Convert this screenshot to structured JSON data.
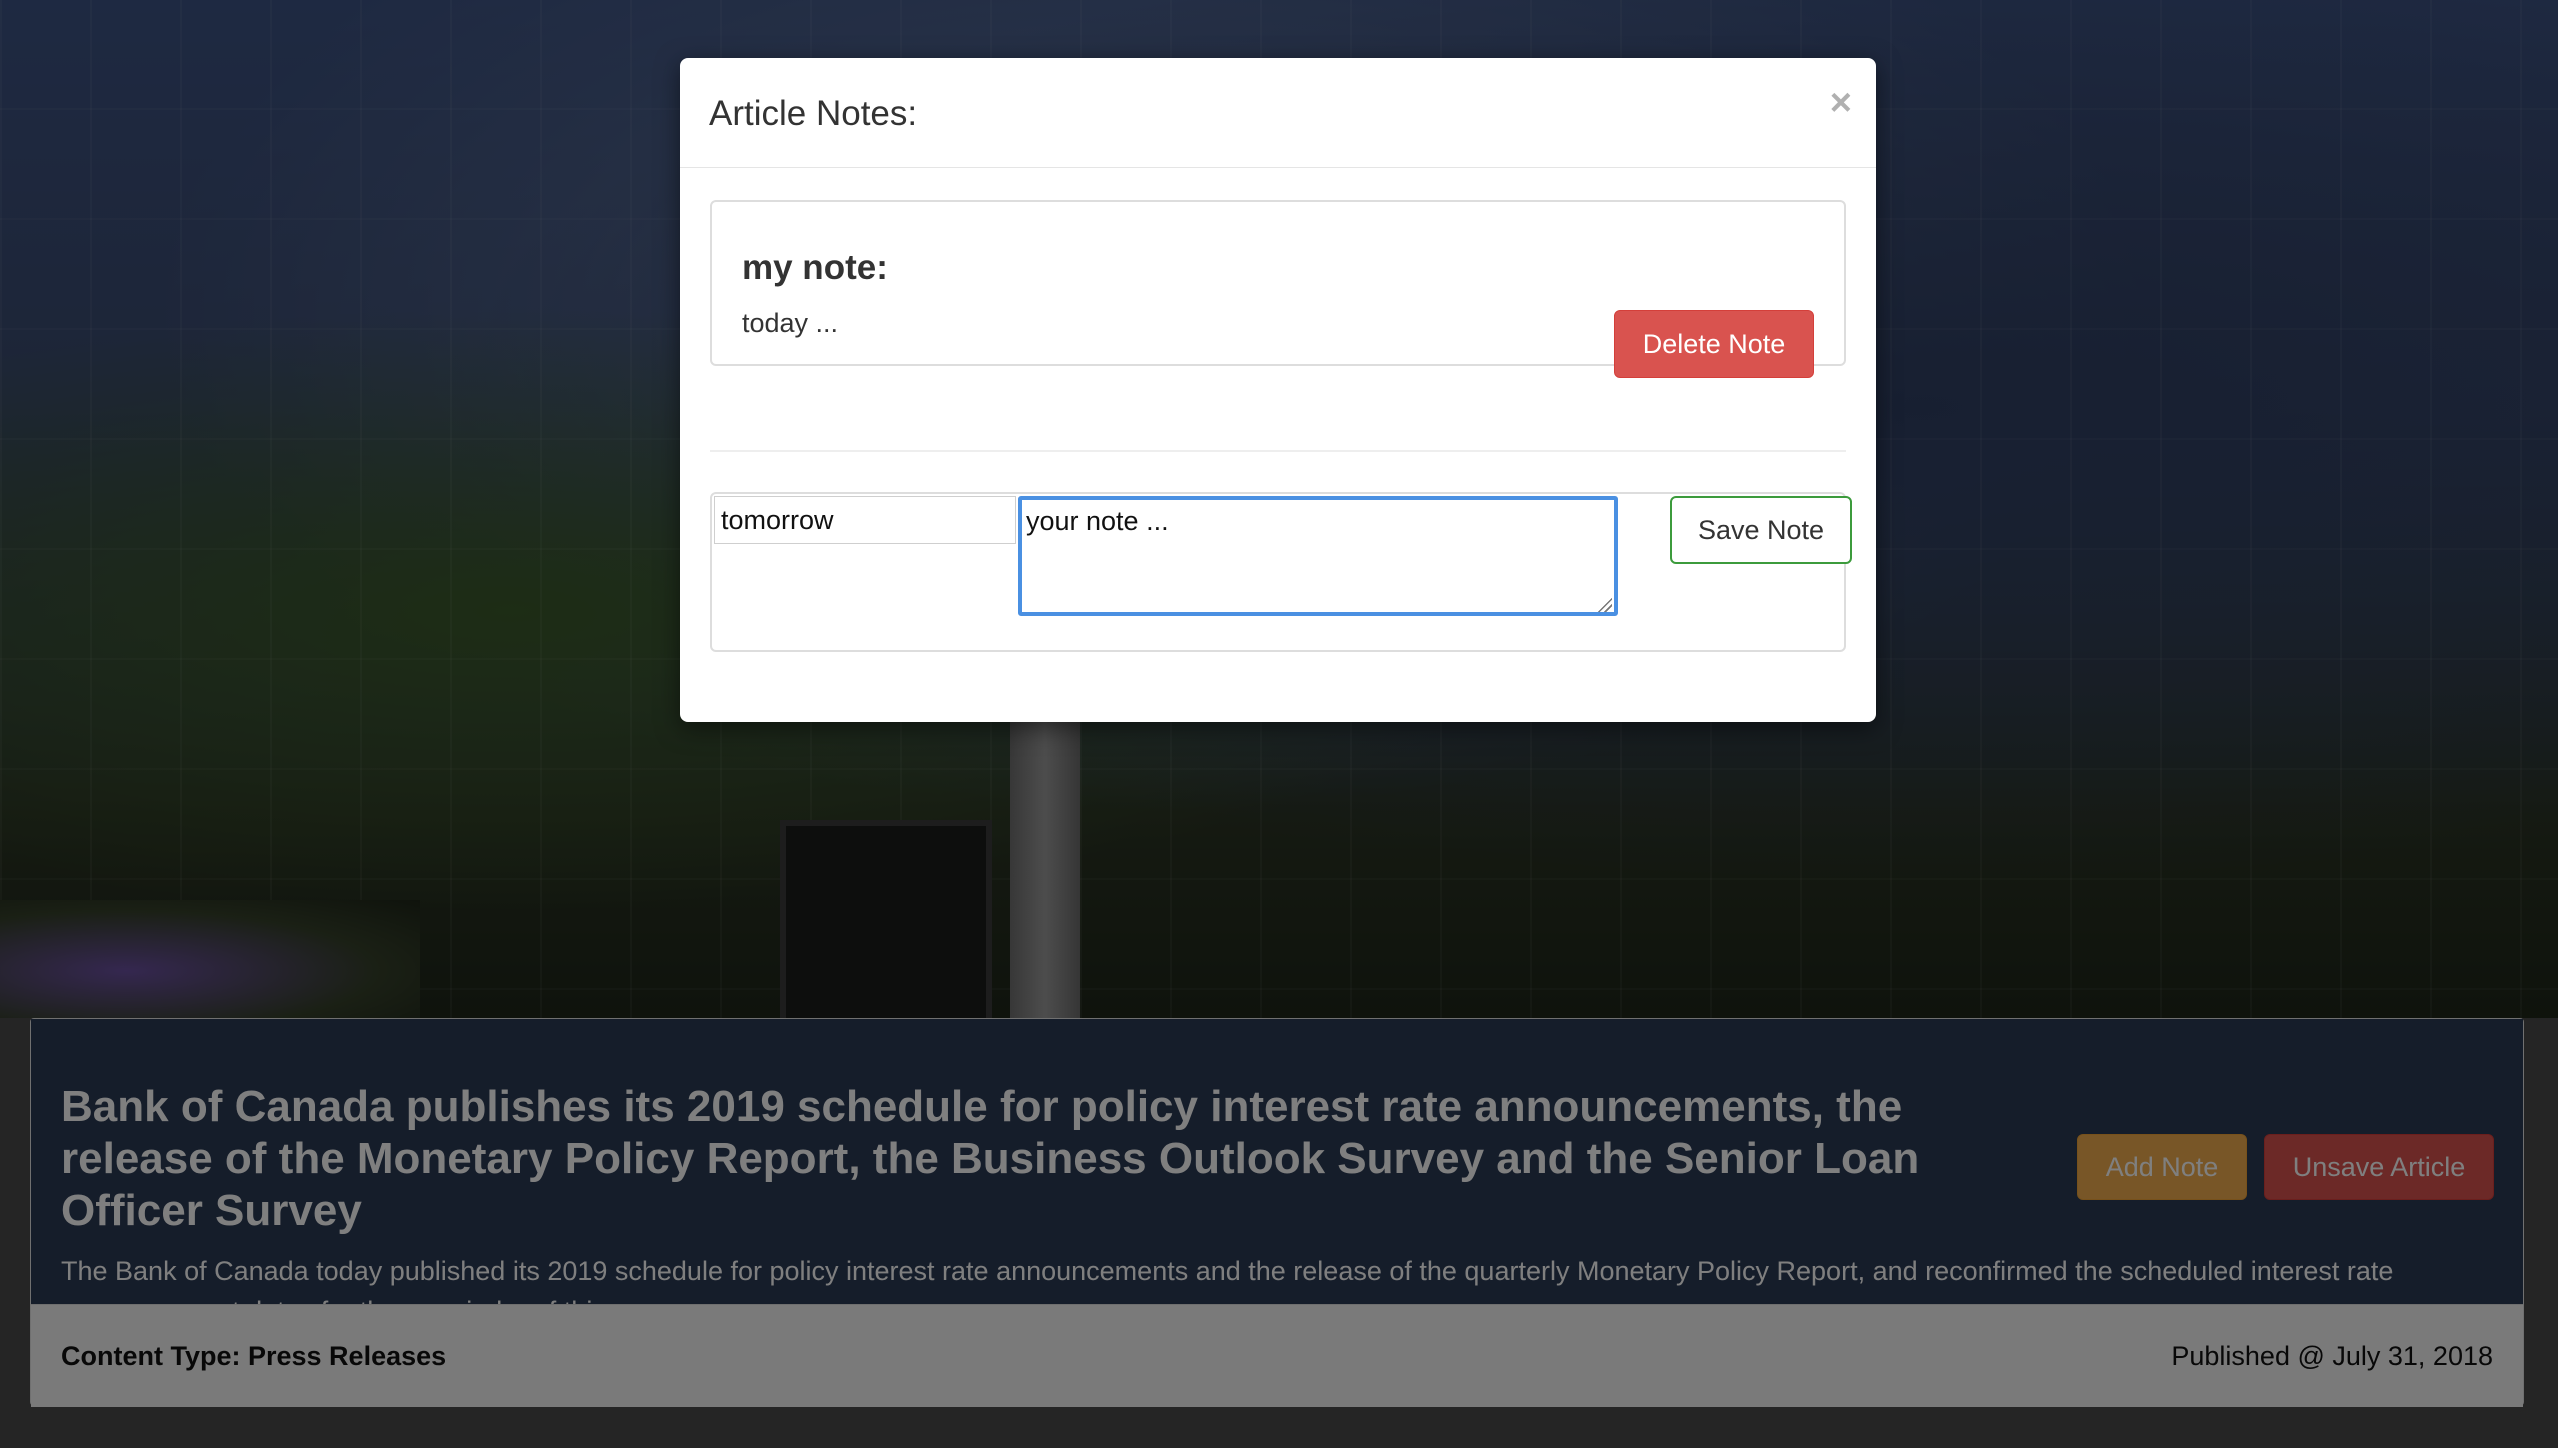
{
  "article": {
    "title": "Bank of Canada publishes its 2019 schedule for policy interest rate announcements, the release of the Monetary Policy Report, the Business Outlook Survey and the Senior Loan Officer Survey",
    "description": "The Bank of Canada today published its 2019 schedule for policy interest rate announcements and the release of the quarterly Monetary Policy Report, and reconfirmed the scheduled interest rate announcement dates for the remainder of this year.",
    "add_note_label": "Add Note",
    "unsave_label": "Unsave Article",
    "content_type": "Content Type: Press Releases",
    "published": "Published @ July 31, 2018"
  },
  "modal": {
    "title": "Article Notes:",
    "close_glyph": "×",
    "existing_note": {
      "title": "my note:",
      "body": "today ...",
      "delete_label": "Delete Note"
    },
    "new_note": {
      "title_value": "tomorrow",
      "body_value": "your note ...",
      "save_label": "Save Note"
    }
  },
  "colors": {
    "danger": "#d9534f",
    "warning": "#f0ad4e",
    "success_border": "#3c9b3c",
    "focus": "#4a90e2",
    "card_header": "#2b3a55"
  }
}
